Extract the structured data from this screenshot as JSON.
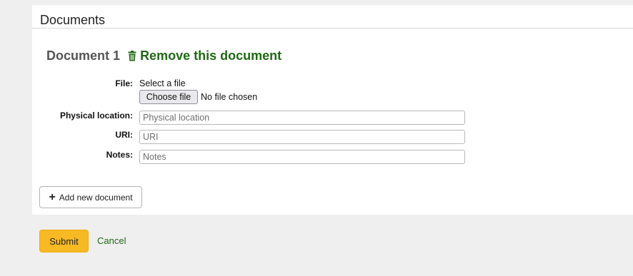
{
  "section": {
    "title": "Documents"
  },
  "document": {
    "heading": "Document 1",
    "remove_label": "Remove this document",
    "remove_icon": "trash-icon"
  },
  "fields": {
    "file": {
      "label": "File:",
      "select_text": "Select a file",
      "button_label": "Choose file",
      "status": "No file chosen"
    },
    "physical_location": {
      "label": "Physical location:",
      "placeholder": "Physical location",
      "value": ""
    },
    "uri": {
      "label": "URI:",
      "placeholder": "URI",
      "value": ""
    },
    "notes": {
      "label": "Notes:",
      "placeholder": "Notes",
      "value": ""
    }
  },
  "actions": {
    "add_document_label": "Add new document",
    "add_icon": "plus-icon",
    "submit_label": "Submit",
    "cancel_label": "Cancel"
  },
  "colors": {
    "page_background": "#efefef",
    "panel_background": "#ffffff",
    "link_green": "#1f6a14",
    "submit_yellow": "#f7b924"
  }
}
